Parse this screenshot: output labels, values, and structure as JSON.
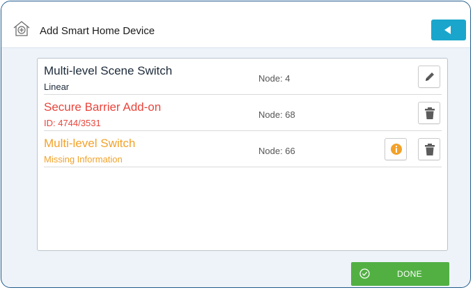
{
  "header": {
    "title": "Add Smart Home Device",
    "home_icon": "home-plus-icon",
    "back_icon": "triangle-left-icon"
  },
  "devices": [
    {
      "name": "Multi-level Scene Switch",
      "subtitle": "Linear",
      "node": "Node: 4",
      "actions": [
        "edit"
      ],
      "name_color": "#1c2a3a",
      "subtitle_color": "#1c2a3a"
    },
    {
      "name": "Secure Barrier Add-on",
      "subtitle": "ID: 4744/3531",
      "node": "Node: 68",
      "actions": [
        "delete"
      ],
      "name_color": "#e8453c",
      "subtitle_color": "#e8453c"
    },
    {
      "name": "Multi-level Switch",
      "subtitle": "Missing Information",
      "node": "Node: 66",
      "actions": [
        "info",
        "delete"
      ],
      "name_color": "#f2a22a",
      "subtitle_color": "#f2a22a"
    }
  ],
  "footer": {
    "done_label": "DONE",
    "done_icon": "check-circle-icon"
  },
  "colors": {
    "accent": "#1aa6cc",
    "success": "#52b043",
    "warning": "#f2a22a",
    "error": "#e8453c",
    "frame": "#1f5a8a"
  }
}
